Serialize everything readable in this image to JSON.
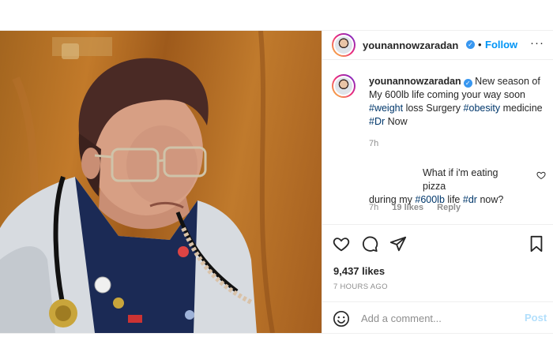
{
  "post": {
    "username": "younannowzaradan",
    "follow_label": "Follow",
    "separator": "•",
    "more_label": "···",
    "caption": {
      "text": "New season of My 600lb life coming your way soon",
      "tags": [
        "#weight",
        "#obesity",
        "#Dr"
      ],
      "words": [
        "loss Surgery",
        "medicine",
        "Now"
      ],
      "time": "7h"
    },
    "comment": {
      "line1": "What if i'm eating pizza",
      "line2_pre": "during my",
      "tags": [
        "#600lb",
        "#dr"
      ],
      "line2_mid": "life",
      "line2_post": "now?",
      "time": "7h",
      "likes": "19 likes",
      "reply": "Reply"
    },
    "likes": "9,437 likes",
    "posted_ago": "7 HOURS AGO",
    "add_comment_placeholder": "Add a comment...",
    "post_label": "Post"
  },
  "icons": {
    "verified": "verified-badge-icon",
    "like": "heart-icon",
    "comment": "comment-icon",
    "share": "paper-plane-icon",
    "save": "bookmark-icon",
    "emoji": "smiley-icon"
  },
  "colors": {
    "link": "#0095f6",
    "hashtag": "#00376b",
    "verified": "#3897f0",
    "muted": "#8e8e8e",
    "post_disabled": "#b2dffc"
  }
}
